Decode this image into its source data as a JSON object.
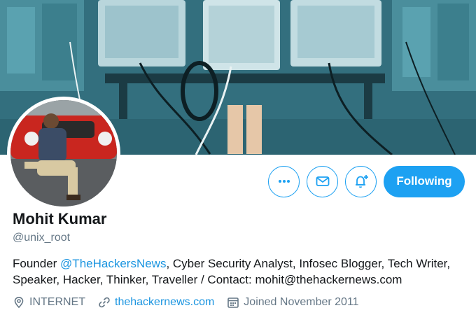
{
  "profile": {
    "name": "Mohit Kumar",
    "handle": "@unix_root",
    "bio": {
      "prefix": "Founder ",
      "mention": "@TheHackersNews",
      "line1_rest": ", Cyber Security Analyst, Infosec Blogger, Tech Writer,",
      "line2": "Speaker, Hacker, Thinker, Traveller / Contact: mohit@thehackernews.com"
    },
    "location": "INTERNET",
    "website": "thehackernews.com",
    "joined": "Joined November 2011"
  },
  "actions": {
    "follow_label": "Following",
    "more_icon": "more-icon",
    "message_icon": "envelope-icon",
    "notifications_icon": "bell-plus-icon"
  },
  "colors": {
    "accent": "#1da1f2",
    "link": "#1b95e0",
    "secondary_text": "#657786"
  }
}
